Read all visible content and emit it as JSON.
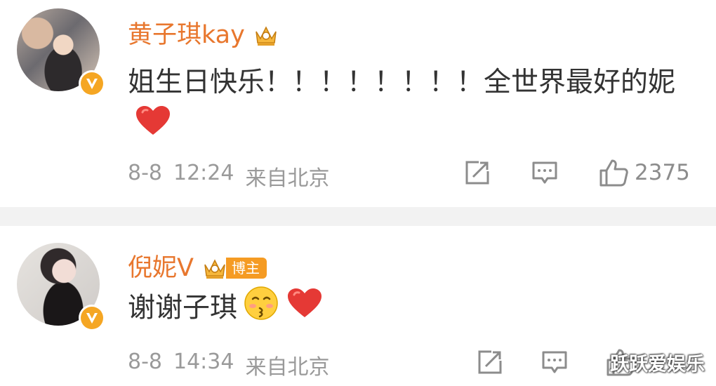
{
  "comments": [
    {
      "username": "黄子琪kay",
      "text": "姐生日快乐！！！！！！！！全世界最好的妮",
      "date": "8-8",
      "time": "12:24",
      "location": "来自北京",
      "likes": "2375",
      "emoji": [
        "red-heart"
      ]
    },
    {
      "username": "倪妮V",
      "host_tag": "博主",
      "text": "谢谢子琪",
      "date": "8-8",
      "time": "14:34",
      "location": "来自北京",
      "likes": "",
      "emoji": [
        "kissing-face",
        "red-heart"
      ]
    }
  ],
  "watermark": "跃跃爱娱乐",
  "colors": {
    "username": "#e8772e",
    "meta": "#9a9a9a",
    "icon": "#8c8c8c",
    "heart": "#e53935",
    "verified": "#f5a623",
    "host_tag": "#f59b23"
  }
}
